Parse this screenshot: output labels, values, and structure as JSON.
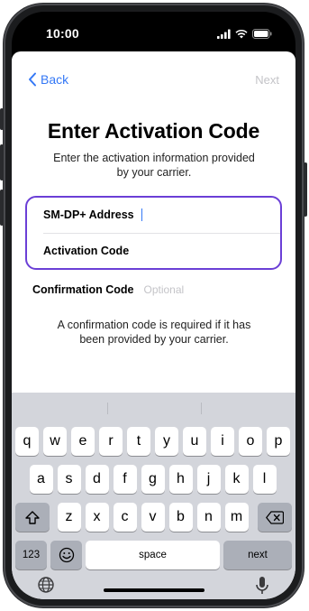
{
  "status_bar": {
    "time": "10:00",
    "icons": [
      "signal-icon",
      "wifi-icon",
      "battery-icon"
    ]
  },
  "nav": {
    "back_label": "Back",
    "next_label": "Next"
  },
  "title": "Enter Activation Code",
  "subtitle": "Enter the activation information provided by your carrier.",
  "fields": {
    "smdp_label": "SM-DP+ Address",
    "activation_label": "Activation Code"
  },
  "confirmation": {
    "label": "Confirmation Code",
    "placeholder": "Optional"
  },
  "note": "A confirmation code is required if it has been provided by your carrier.",
  "keyboard": {
    "row1": [
      "q",
      "w",
      "e",
      "r",
      "t",
      "y",
      "u",
      "i",
      "o",
      "p"
    ],
    "row2": [
      "a",
      "s",
      "d",
      "f",
      "g",
      "h",
      "j",
      "k",
      "l"
    ],
    "row3": [
      "z",
      "x",
      "c",
      "v",
      "b",
      "n",
      "m"
    ],
    "numbers_label": "123",
    "space_label": "space",
    "next_label": "next"
  },
  "colors": {
    "accent": "#3478f6",
    "focus_border": "#6b3fd6",
    "keyboard_bg": "#d3d5db"
  }
}
